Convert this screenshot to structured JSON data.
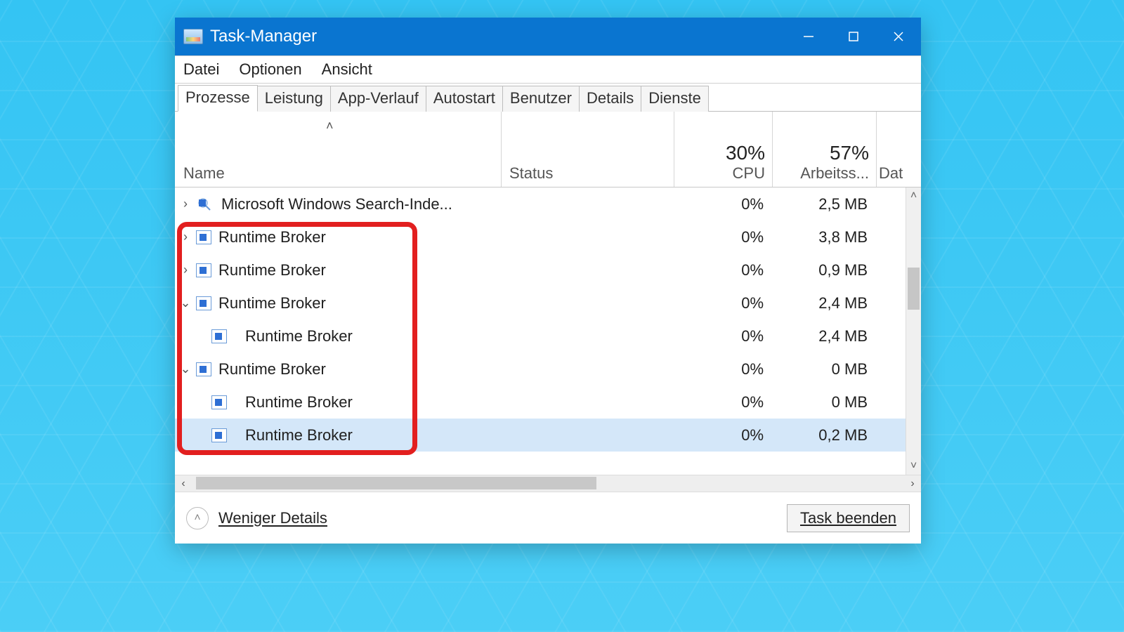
{
  "window": {
    "title": "Task-Manager"
  },
  "menu": {
    "items": [
      "Datei",
      "Optionen",
      "Ansicht"
    ]
  },
  "tabs": {
    "items": [
      "Prozesse",
      "Leistung",
      "App-Verlauf",
      "Autostart",
      "Benutzer",
      "Details",
      "Dienste"
    ],
    "active": 0
  },
  "columns": {
    "name": "Name",
    "status": "Status",
    "cpu_pct": "30%",
    "cpu_label": "CPU",
    "mem_pct": "57%",
    "mem_label": "Arbeitss...",
    "data_label": "Dat"
  },
  "rows": [
    {
      "expander": "›",
      "iconType": "search",
      "indent": 0,
      "name": "Microsoft Windows Search-Inde...",
      "cpu": "0%",
      "mem": "2,5 MB",
      "memHeat": "dark",
      "selected": false
    },
    {
      "expander": "›",
      "iconType": "rb",
      "indent": 0,
      "name": "Runtime Broker",
      "cpu": "0%",
      "mem": "3,8 MB",
      "memHeat": "dark",
      "selected": false
    },
    {
      "expander": "›",
      "iconType": "rb",
      "indent": 0,
      "name": "Runtime Broker",
      "cpu": "0%",
      "mem": "0,9 MB",
      "memHeat": "light",
      "selected": false
    },
    {
      "expander": "⌄",
      "iconType": "rb",
      "indent": 0,
      "name": "Runtime Broker",
      "cpu": "0%",
      "mem": "2,4 MB",
      "memHeat": "dark",
      "selected": false
    },
    {
      "expander": "",
      "iconType": "rb",
      "indent": 1,
      "name": "Runtime Broker",
      "cpu": "0%",
      "mem": "2,4 MB",
      "memHeat": "dark",
      "selected": false
    },
    {
      "expander": "⌄",
      "iconType": "rb",
      "indent": 0,
      "name": "Runtime Broker",
      "cpu": "0%",
      "mem": "0 MB",
      "memHeat": "light",
      "selected": false
    },
    {
      "expander": "",
      "iconType": "rb",
      "indent": 1,
      "name": "Runtime Broker",
      "cpu": "0%",
      "mem": "0 MB",
      "memHeat": "light",
      "selected": false
    },
    {
      "expander": "",
      "iconType": "rb",
      "indent": 1,
      "name": "Runtime Broker",
      "cpu": "0%",
      "mem": "0,2 MB",
      "memHeat": "light",
      "selected": true
    }
  ],
  "footer": {
    "less_details": "Weniger Details",
    "end_task": "Task beenden"
  }
}
